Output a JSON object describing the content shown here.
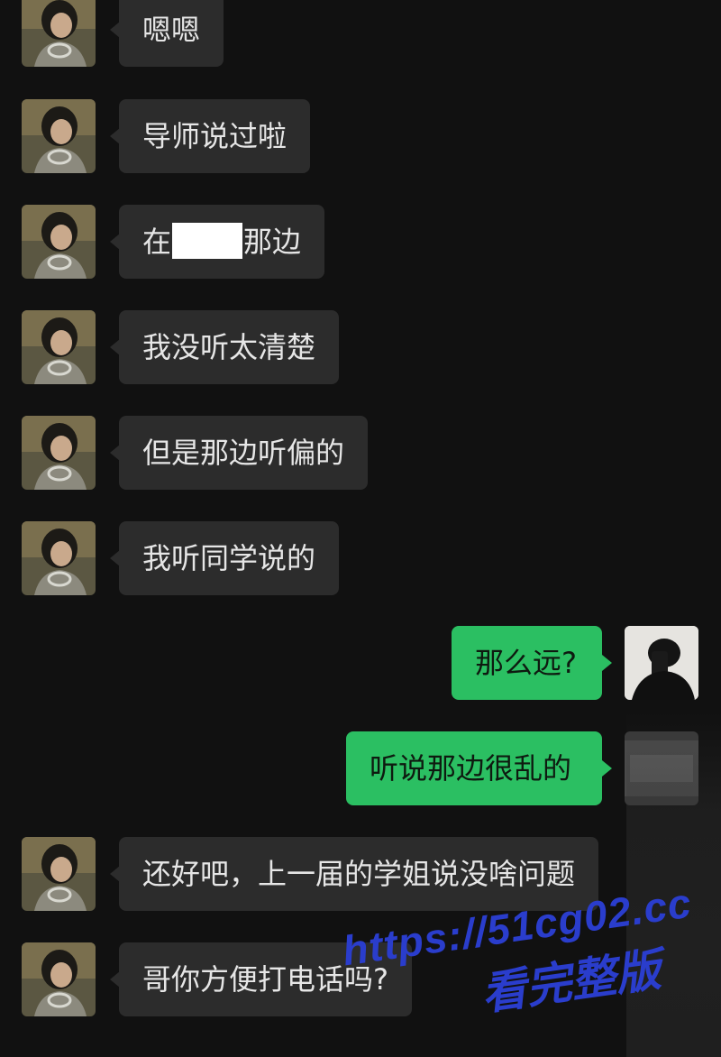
{
  "messages": [
    {
      "side": "in",
      "text": "嗯嗯"
    },
    {
      "side": "in",
      "text": "导师说过啦"
    },
    {
      "side": "in",
      "text_before": "在",
      "text_after": "那边"
    },
    {
      "side": "in",
      "text": "我没听太清楚"
    },
    {
      "side": "in",
      "text": "但是那边听偏的"
    },
    {
      "side": "in",
      "text": "我听同学说的"
    },
    {
      "side": "out",
      "text": "那么远?"
    },
    {
      "side": "out",
      "text": "听说那边很乱的"
    },
    {
      "side": "in",
      "text": "还好吧，上一届的学姐说没啥问题"
    },
    {
      "side": "in",
      "text": "哥你方便打电话吗?"
    }
  ],
  "watermark": {
    "url": "https://51cg02.cc",
    "subtitle": "看完整版"
  },
  "colors": {
    "background": "#111111",
    "incoming_bubble": "#2c2c2c",
    "outgoing_bubble": "#2bbf62",
    "watermark": "#2a3dcc"
  }
}
